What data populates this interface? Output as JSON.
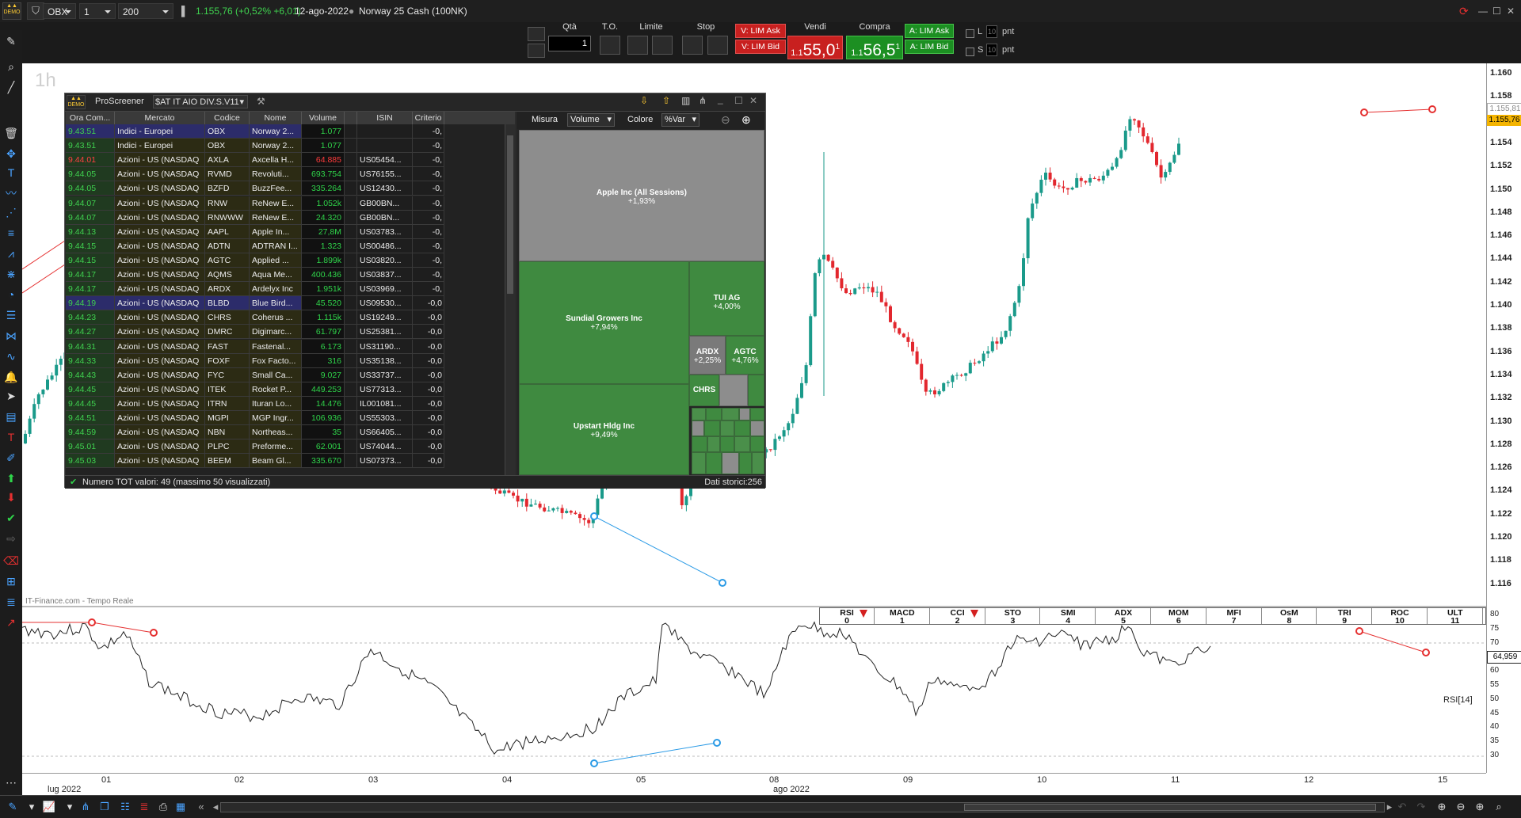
{
  "topbar": {
    "symbol": "OBX",
    "timeframe": "1 ora",
    "units": "200 unità",
    "quote": "1.155,76 (+0,52% +6,01)",
    "date": "12-ago-2022",
    "instrument": "Norway 25 Cash (100NK)"
  },
  "orderbar": {
    "qty_label": "Qtà",
    "qty_value": "1",
    "to_label": "T.O.",
    "limit_label": "Limite",
    "stop_label": "Stop",
    "v_lim_ask": "V: LIM Ask",
    "v_lim_bid": "V: LIM Bid",
    "sell_label": "Vendi",
    "sell_prefix": "1.1",
    "sell_main": "55,0",
    "sell_sup": "1",
    "buy_label": "Compra",
    "buy_prefix": "1.1",
    "buy_main": "56,5",
    "buy_sup": "1",
    "a_lim_ask": "A: LIM Ask",
    "a_lim_bid": "A: LIM Bid",
    "l_label": "L",
    "s_label": "S",
    "l_value": "10",
    "s_value": "10",
    "pnt": "pnt"
  },
  "chart": {
    "timeframe_watermark": "1h",
    "source": "IT-Finance.com - Tempo Reale",
    "price_labels": [
      "1.160",
      "1.158",
      "1.156",
      "1.154",
      "1.152",
      "1.150",
      "1.148",
      "1.146",
      "1.144",
      "1.142",
      "1.140",
      "1.138",
      "1.136",
      "1.134",
      "1.132",
      "1.130",
      "1.128",
      "1.126",
      "1.124",
      "1.122",
      "1.120",
      "1.118",
      "1.116"
    ],
    "price_tag_grey": "1.155,81",
    "price_tag_yellow": "1.155,76",
    "rsi_labels": [
      "80",
      "75",
      "70",
      "65",
      "60",
      "55",
      "50",
      "45",
      "40",
      "35",
      "30"
    ],
    "rsi_value": "64,959",
    "rsi_name": "RSI[14]",
    "dates": [
      "01",
      "02",
      "03",
      "04",
      "05",
      "08",
      "09",
      "10",
      "11",
      "12",
      "15"
    ],
    "month_labels": [
      "lug 2022",
      "ago 2022"
    ],
    "colors": {
      "up": "#1a9a8a",
      "down": "#e2272e",
      "trend_red": "#e53030",
      "trend_blue": "#2b9be6"
    }
  },
  "indicator_tabs": [
    {
      "name": "RSI",
      "num": "0",
      "arrow": true
    },
    {
      "name": "MACD",
      "num": "1",
      "arrow": false
    },
    {
      "name": "CCI",
      "num": "2",
      "arrow": true
    },
    {
      "name": "STO",
      "num": "3",
      "arrow": false
    },
    {
      "name": "SMI",
      "num": "4",
      "arrow": false
    },
    {
      "name": "ADX",
      "num": "5",
      "arrow": false
    },
    {
      "name": "MOM",
      "num": "6",
      "arrow": false
    },
    {
      "name": "MFI",
      "num": "7",
      "arrow": false
    },
    {
      "name": "OsM",
      "num": "8",
      "arrow": false
    },
    {
      "name": "TRI",
      "num": "9",
      "arrow": false
    },
    {
      "name": "ROC",
      "num": "10",
      "arrow": false
    },
    {
      "name": "ULT",
      "num": "11",
      "arrow": false
    }
  ],
  "proscreener": {
    "title": "ProScreener",
    "screener_name": "$AT IT AIO DIV.S.V11",
    "columns": [
      "Ora Com...",
      "Mercato",
      "Codice",
      "Nome",
      "Volume",
      "",
      "ISIN",
      "Criterio"
    ],
    "rows": [
      [
        "9.43.51",
        "Indici - Europei",
        "OBX",
        "Norway 2...",
        "1.077",
        "",
        "",
        "-0,"
      ],
      [
        "9.43.51",
        "Indici - Europei",
        "OBX",
        "Norway 2...",
        "1.077",
        "",
        "",
        "-0,"
      ],
      [
        "9.44.01",
        "Azioni - US (NASDAQ",
        "AXLA",
        "Axcella H...",
        "64.885",
        "",
        "US05454...",
        "-0,"
      ],
      [
        "9.44.05",
        "Azioni - US (NASDAQ",
        "RVMD",
        "Revoluti...",
        "693.754",
        "",
        "US76155...",
        "-0,"
      ],
      [
        "9.44.05",
        "Azioni - US (NASDAQ",
        "BZFD",
        "BuzzFee...",
        "335.264",
        "",
        "US12430...",
        "-0,"
      ],
      [
        "9.44.07",
        "Azioni - US (NASDAQ",
        "RNW",
        "ReNew E...",
        "1.052k",
        "",
        "GB00BN...",
        "-0,"
      ],
      [
        "9.44.07",
        "Azioni - US (NASDAQ",
        "RNWWW",
        "ReNew E...",
        "24.320",
        "",
        "GB00BN...",
        "-0,"
      ],
      [
        "9.44.13",
        "Azioni - US (NASDAQ",
        "AAPL",
        "Apple In...",
        "27,8M",
        "",
        "US03783...",
        "-0,"
      ],
      [
        "9.44.15",
        "Azioni - US (NASDAQ",
        "ADTN",
        "ADTRAN I...",
        "1.323",
        "",
        "US00486...",
        "-0,"
      ],
      [
        "9.44.15",
        "Azioni - US (NASDAQ",
        "AGTC",
        "Applied ...",
        "1.899k",
        "",
        "US03820...",
        "-0,"
      ],
      [
        "9.44.17",
        "Azioni - US (NASDAQ",
        "AQMS",
        "Aqua Me...",
        "400.436",
        "",
        "US03837...",
        "-0,"
      ],
      [
        "9.44.17",
        "Azioni - US (NASDAQ",
        "ARDX",
        "Ardelyx Inc",
        "1.951k",
        "",
        "US03969...",
        "-0,"
      ],
      [
        "9.44.19",
        "Azioni - US (NASDAQ",
        "BLBD",
        "Blue Bird...",
        "45.520",
        "",
        "US09530...",
        "-0,0"
      ],
      [
        "9.44.23",
        "Azioni - US (NASDAQ",
        "CHRS",
        "Coherus ...",
        "1.115k",
        "",
        "US19249...",
        "-0,0"
      ],
      [
        "9.44.27",
        "Azioni - US (NASDAQ",
        "DMRC",
        "Digimarc...",
        "61.797",
        "",
        "US25381...",
        "-0,0"
      ],
      [
        "9.44.31",
        "Azioni - US (NASDAQ",
        "FAST",
        "Fastenal...",
        "6.173",
        "",
        "US31190...",
        "-0,0"
      ],
      [
        "9.44.33",
        "Azioni - US (NASDAQ",
        "FOXF",
        "Fox Facto...",
        "316",
        "",
        "US35138...",
        "-0,0"
      ],
      [
        "9.44.43",
        "Azioni - US (NASDAQ",
        "FYC",
        "Small Ca...",
        "9.027",
        "",
        "US33737...",
        "-0,0"
      ],
      [
        "9.44.45",
        "Azioni - US (NASDAQ",
        "ITEK",
        "Rocket P...",
        "449.253",
        "",
        "US77313...",
        "-0,0"
      ],
      [
        "9.44.45",
        "Azioni - US (NASDAQ",
        "ITRN",
        "Ituran Lo...",
        "14.476",
        "",
        "IL001081...",
        "-0,0"
      ],
      [
        "9.44.51",
        "Azioni - US (NASDAQ",
        "MGPI",
        "MGP Ingr...",
        "106.936",
        "",
        "US55303...",
        "-0,0"
      ],
      [
        "9.44.59",
        "Azioni - US (NASDAQ",
        "NBN",
        "Northeas...",
        "35",
        "",
        "US66405...",
        "-0,0"
      ],
      [
        "9.45.01",
        "Azioni - US (NASDAQ",
        "PLPC",
        "Preforme...",
        "62.001",
        "",
        "US74044...",
        "-0,0"
      ],
      [
        "9.45.03",
        "Azioni - US (NASDAQ",
        "BEEM",
        "Beam Gl...",
        "335.670",
        "",
        "US07373...",
        "-0,0"
      ]
    ],
    "volume_colors": [
      "#2fd44a",
      "#2fd44a",
      "#ff3b3b",
      "#2fd44a",
      "#2fd44a",
      "#2fd44a",
      "#2fd44a",
      "#2fd44a",
      "#2fd44a",
      "#2fd44a",
      "#2fd44a",
      "#2fd44a",
      "#2fd44a",
      "#2fd44a",
      "#2fd44a",
      "#2fd44a",
      "#2fd44a",
      "#2fd44a",
      "#2fd44a",
      "#2fd44a",
      "#2fd44a",
      "#2fd44a",
      "#2fd44a",
      "#2fd44a"
    ],
    "misura_label": "Misura",
    "misura_value": "Volume",
    "colore_label": "Colore",
    "colore_value": "%Var",
    "treemap": [
      {
        "name": "Apple Inc (All Sessions)",
        "pct": "+1,93%"
      },
      {
        "name": "Sundial Growers Inc",
        "pct": "+7,94%"
      },
      {
        "name": "TUI AG",
        "pct": "+4,00%"
      },
      {
        "name": "ARDX",
        "pct": "+2,25%"
      },
      {
        "name": "AGTC",
        "pct": "+4,76%"
      },
      {
        "name": "CHRS",
        "pct": ""
      },
      {
        "name": "Upstart Hldg Inc",
        "pct": "+9,49%"
      }
    ],
    "footer_left": "Numero TOT valori: 49 (massimo 50 visualizzati)",
    "footer_right": "Dati storici:256"
  }
}
